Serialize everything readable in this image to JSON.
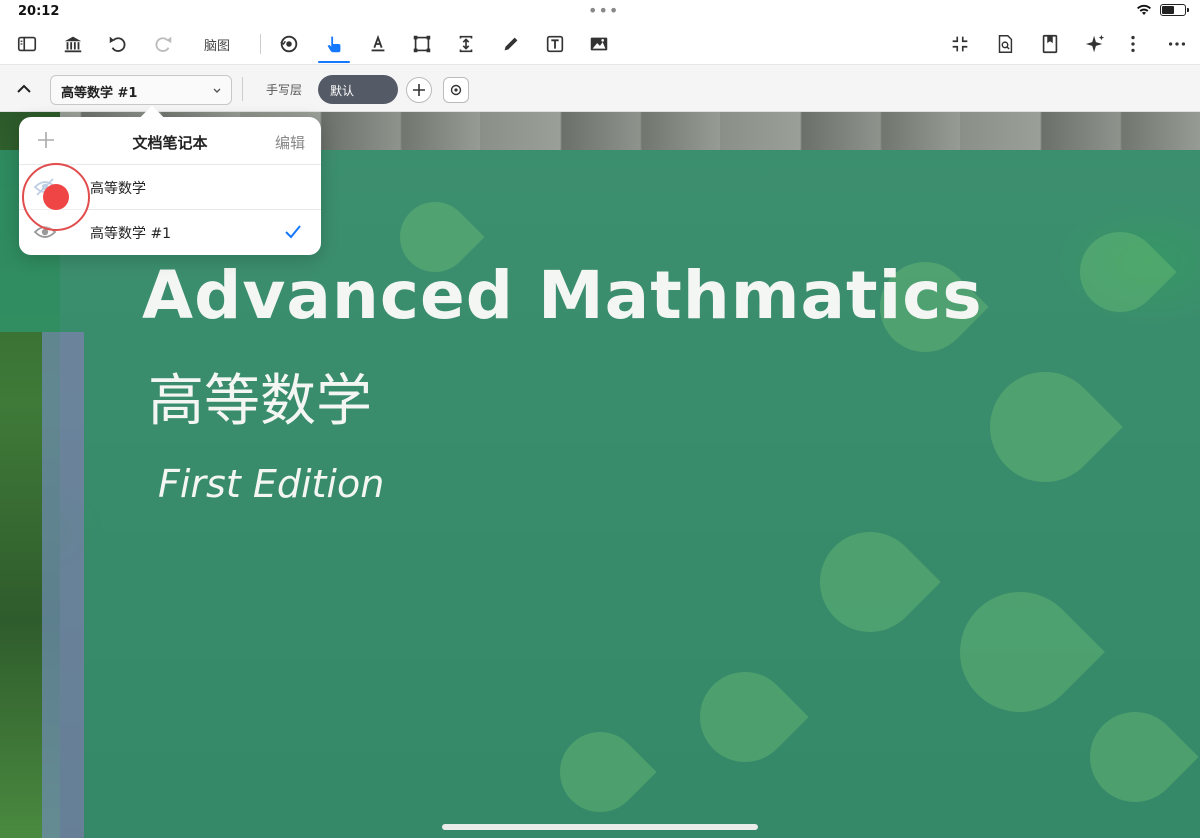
{
  "status_bar": {
    "time": "20:12",
    "dots": "•••",
    "battery_level": 0.5
  },
  "toolbar": {
    "items": [
      {
        "icon": "sidebar-icon"
      },
      {
        "icon": "library-icon"
      },
      {
        "icon": "undo-icon"
      },
      {
        "icon": "redo-icon"
      },
      {
        "icon": "mindmap-label",
        "label": "脑图"
      },
      {
        "icon": "sync-gear-icon"
      },
      {
        "icon": "pointer-hand-icon",
        "active": true
      },
      {
        "icon": "text-highlight-icon"
      },
      {
        "icon": "select-rect-icon"
      },
      {
        "icon": "insert-space-icon"
      },
      {
        "icon": "pen-icon"
      },
      {
        "icon": "textbox-icon"
      },
      {
        "icon": "image-icon"
      },
      {
        "icon": "collapse-icon"
      },
      {
        "icon": "search-doc-icon"
      },
      {
        "icon": "bookmark-icon"
      },
      {
        "icon": "ai-sparkle-icon"
      },
      {
        "icon": "more-vertical-icon"
      },
      {
        "icon": "more-horizontal-icon"
      }
    ],
    "mindmap_label": "脑图",
    "accent_color": "#1677ff"
  },
  "subbar": {
    "notebook_selected": "高等数学 #1",
    "layer_label": "手写层",
    "default_pill": "默认"
  },
  "popover": {
    "title": "文档笔记本",
    "edit_label": "编辑",
    "rows": [
      {
        "label": "高等数学",
        "checked": false
      },
      {
        "label": "高等数学 #1",
        "checked": true
      }
    ]
  },
  "cover": {
    "title": "Advanced Mathmatics",
    "subtitle_cn": "高等数学",
    "edition": "First Edition",
    "overlay_color": "#2e966e"
  },
  "touch_indicator_color": "#f04545"
}
